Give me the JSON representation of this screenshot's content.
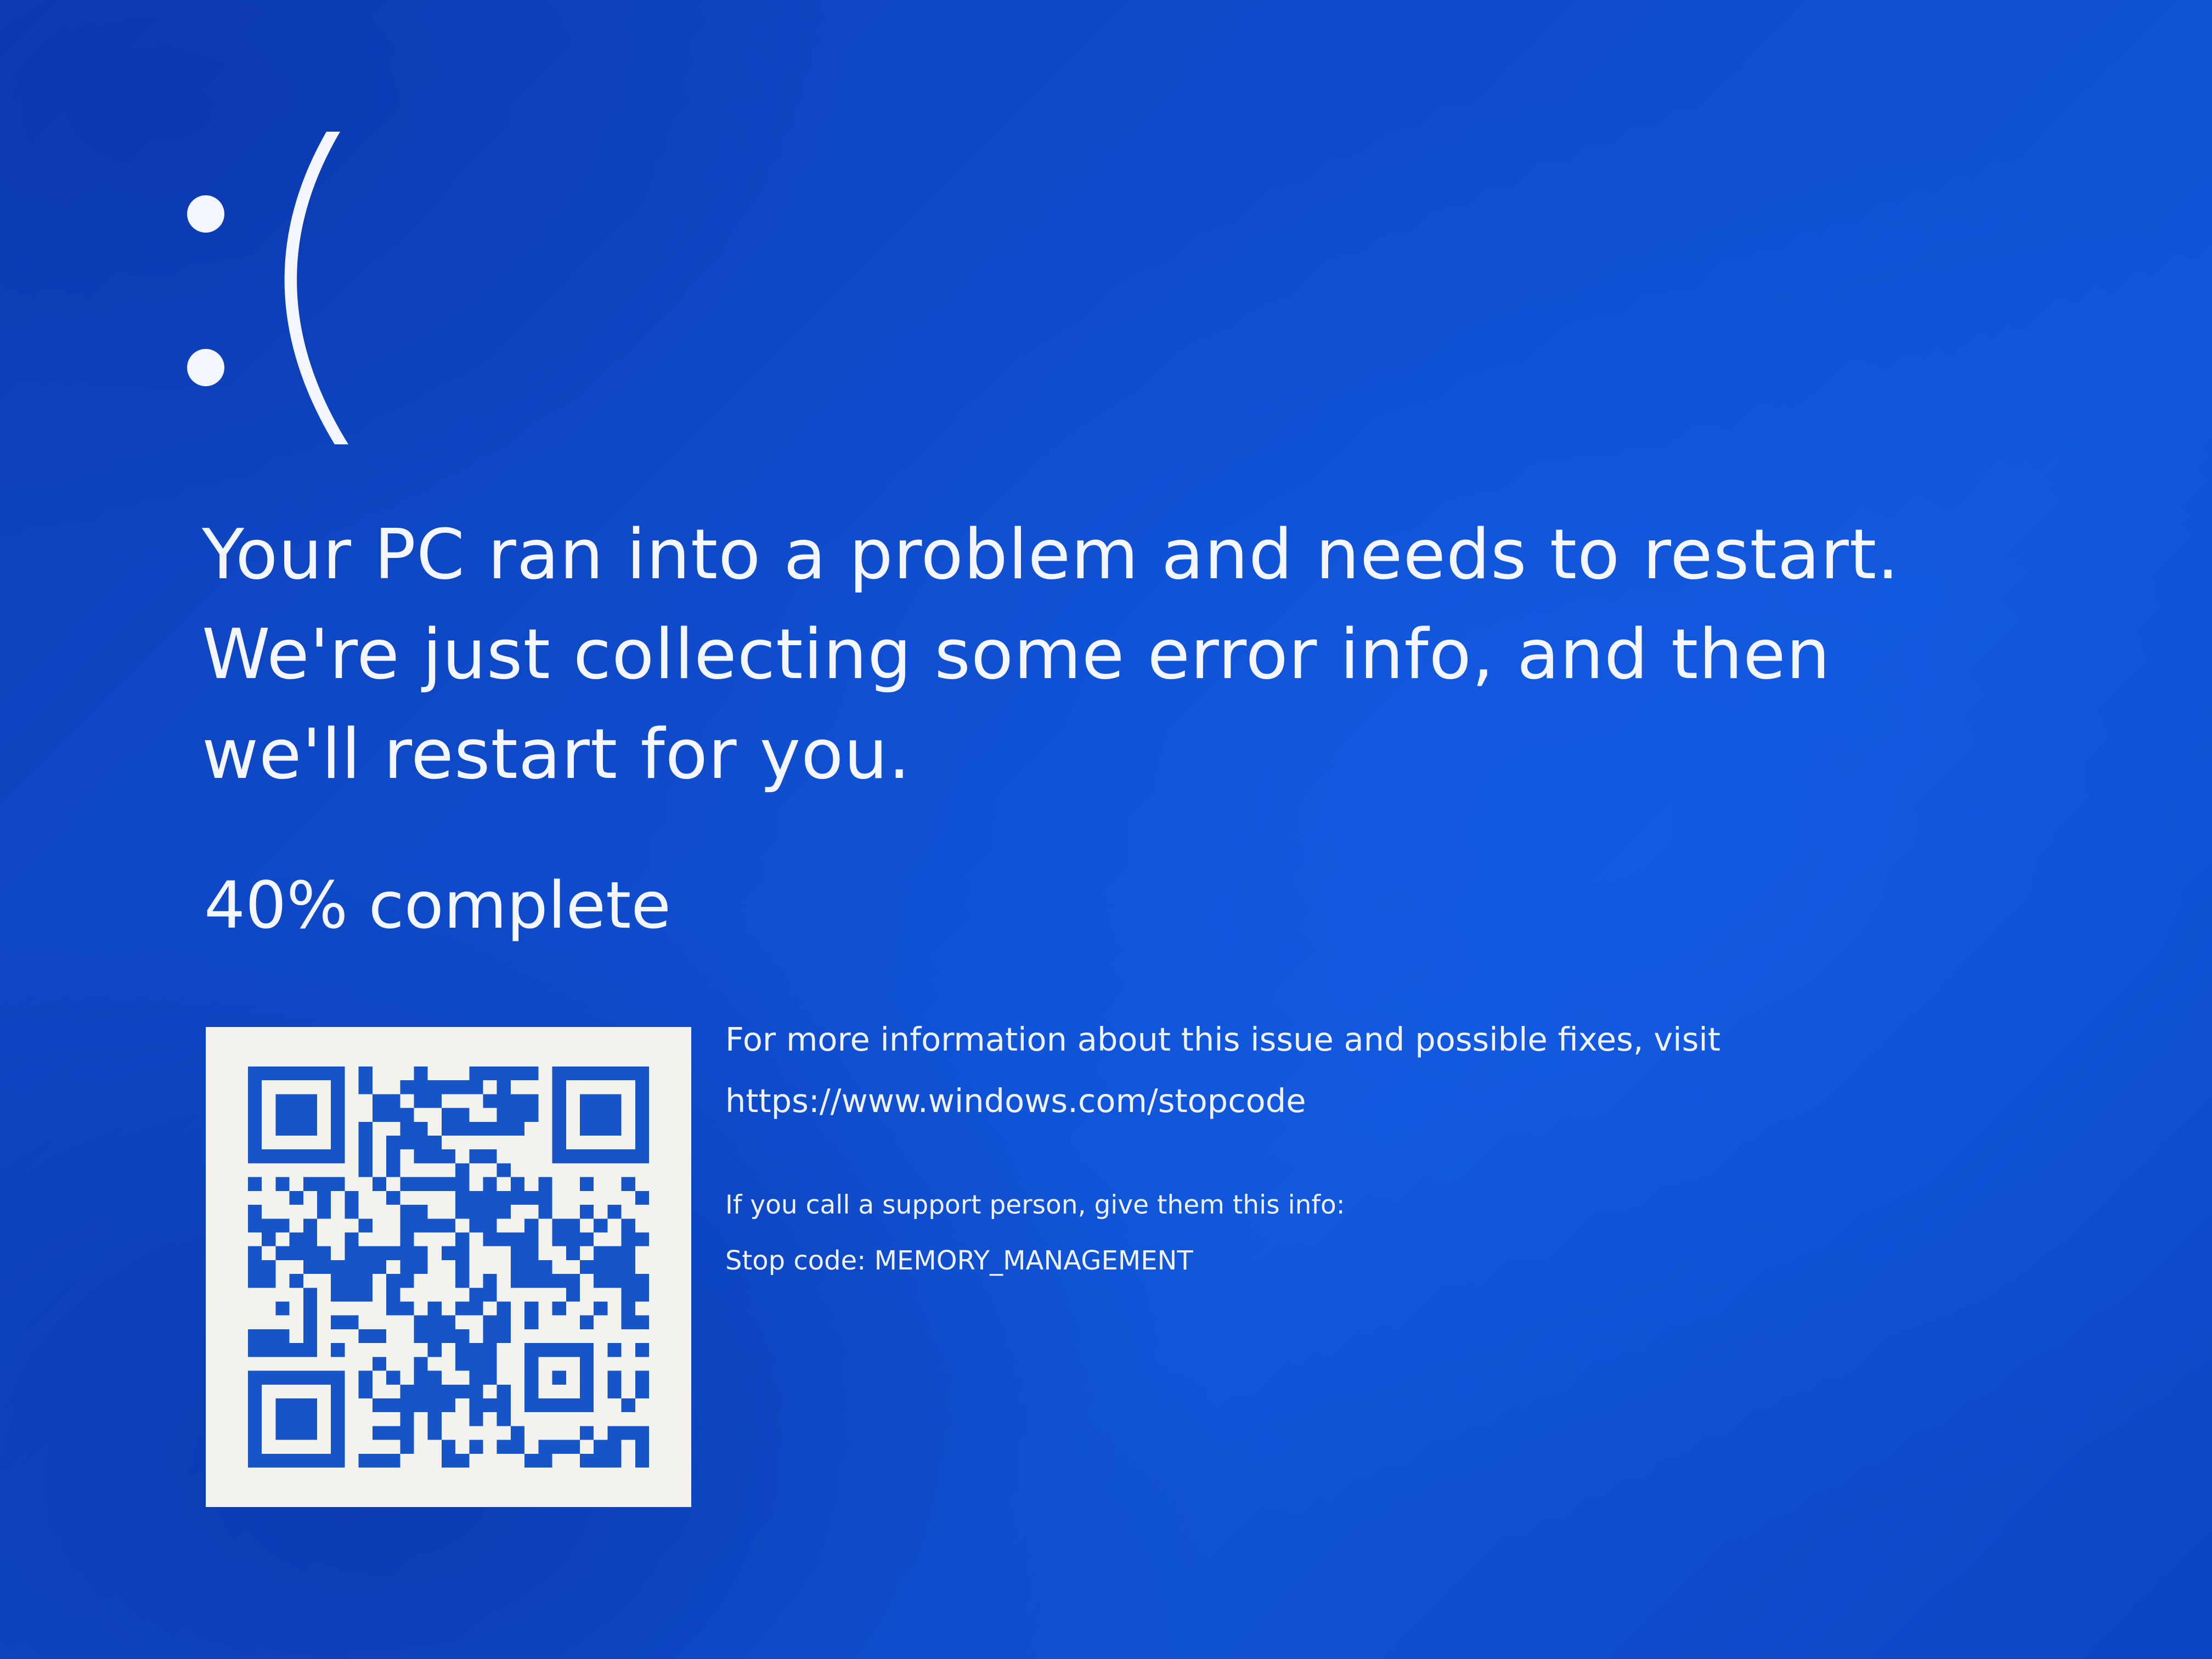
{
  "screen": {
    "background_color": "#0f4ecf",
    "text_color": "#f4f6ff"
  },
  "sad_face": {
    "text": ":(",
    "icon": "sad-face-icon"
  },
  "message": {
    "text": "Your PC ran into a problem and needs to restart. We're just collecting some error info, and then we'll restart for you."
  },
  "progress": {
    "percent": 40,
    "text": "40% complete"
  },
  "qr_code": {
    "icon": "qr-code-icon",
    "foreground_color": "#1555c8",
    "background_color": "#f3f2ec"
  },
  "info": {
    "more_info": "For more information about this issue and possible fixes, visit",
    "url": "https://www.windows.com/stopcode",
    "support": "If you call a support person, give them this info:",
    "stop_code": "Stop code: MEMORY_MANAGEMENT"
  }
}
